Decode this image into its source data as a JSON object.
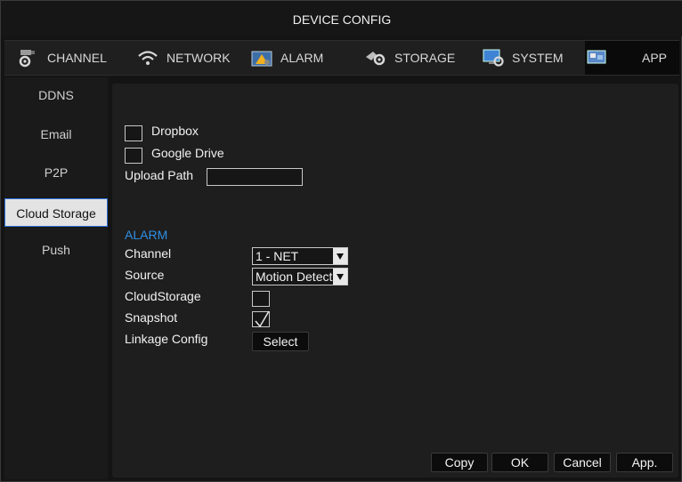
{
  "window": {
    "title": "DEVICE CONFIG"
  },
  "tabs": [
    {
      "label": "CHANNEL",
      "icon": "camera-gear-icon"
    },
    {
      "label": "NETWORK",
      "icon": "wifi-icon"
    },
    {
      "label": "ALARM",
      "icon": "alarm-icon"
    },
    {
      "label": "STORAGE",
      "icon": "storage-gear-icon"
    },
    {
      "label": "SYSTEM",
      "icon": "system-monitor-icon"
    },
    {
      "label": "APP",
      "icon": "app-icon"
    }
  ],
  "active_tab": "APP",
  "sidebar": {
    "items": [
      {
        "label": "DDNS"
      },
      {
        "label": "Email"
      },
      {
        "label": "P2P"
      },
      {
        "label": "Cloud Storage"
      },
      {
        "label": "Push"
      }
    ],
    "active": "Cloud Storage"
  },
  "cloud": {
    "dropbox_label": "Dropbox",
    "dropbox_checked": false,
    "google_drive_label": "Google Drive",
    "google_drive_checked": false,
    "upload_path_label": "Upload Path",
    "upload_path_value": ""
  },
  "alarm": {
    "section_title": "ALARM",
    "channel_label": "Channel",
    "channel_value": "1 - NET",
    "source_label": "Source",
    "source_value": "Motion Detect",
    "cloudstorage_label": "CloudStorage",
    "cloudstorage_checked": false,
    "snapshot_label": "Snapshot",
    "snapshot_checked": true,
    "linkage_label": "Linkage Config",
    "select_button": "Select"
  },
  "footer": {
    "copy_label": "Copy",
    "ok_label": "OK",
    "cancel_label": "Cancel",
    "apply_label": "App."
  },
  "colors": {
    "accent": "#2f8fe6",
    "background": "#141414",
    "panel": "#1e1e1e"
  }
}
